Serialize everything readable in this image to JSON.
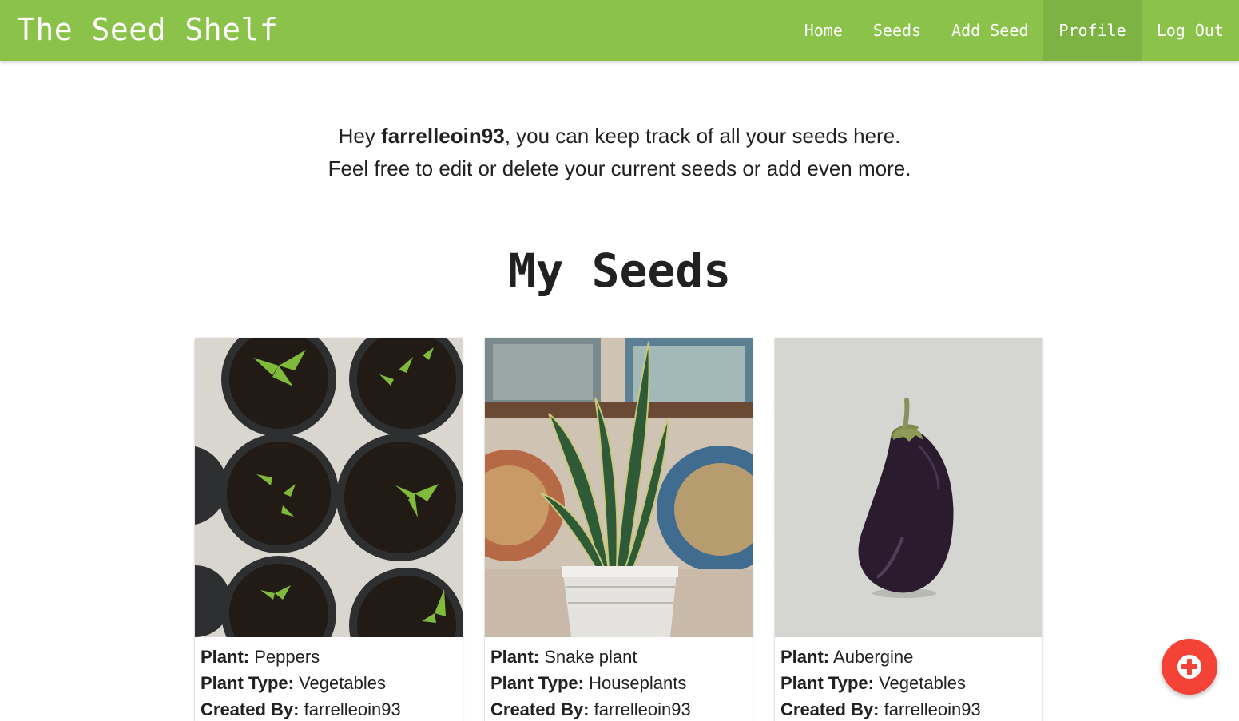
{
  "app": {
    "brand": "The Seed Shelf"
  },
  "nav": {
    "items": [
      {
        "label": "Home"
      },
      {
        "label": "Seeds"
      },
      {
        "label": "Add Seed"
      },
      {
        "label": "Profile",
        "active": true
      },
      {
        "label": "Log Out"
      }
    ]
  },
  "intro": {
    "greeting_prefix": "Hey ",
    "username": "farrelleoin93",
    "greeting_suffix": ", you can keep track of all your seeds here.",
    "line2": "Feel free to edit or delete your current seeds or add even more."
  },
  "section": {
    "title": "My Seeds"
  },
  "labels": {
    "plant": "Plant:",
    "plant_type": "Plant Type:",
    "created_by": "Created By:"
  },
  "seeds": [
    {
      "plant": "Peppers",
      "plant_type": "Vegetables",
      "created_by": "farrelleoin93",
      "image": "pepper-seedlings-image"
    },
    {
      "plant": "Snake plant",
      "plant_type": "Houseplants",
      "created_by": "farrelleoin93",
      "image": "snake-plant-image"
    },
    {
      "plant": "Aubergine",
      "plant_type": "Vegetables",
      "created_by": "farrelleoin93",
      "image": "aubergine-image"
    }
  ],
  "fab": {
    "icon": "add-circle-icon"
  },
  "colors": {
    "navbar": "#8bc34a",
    "nav_active": "#7cb342",
    "fab": "#f44336",
    "text": "#212121"
  }
}
